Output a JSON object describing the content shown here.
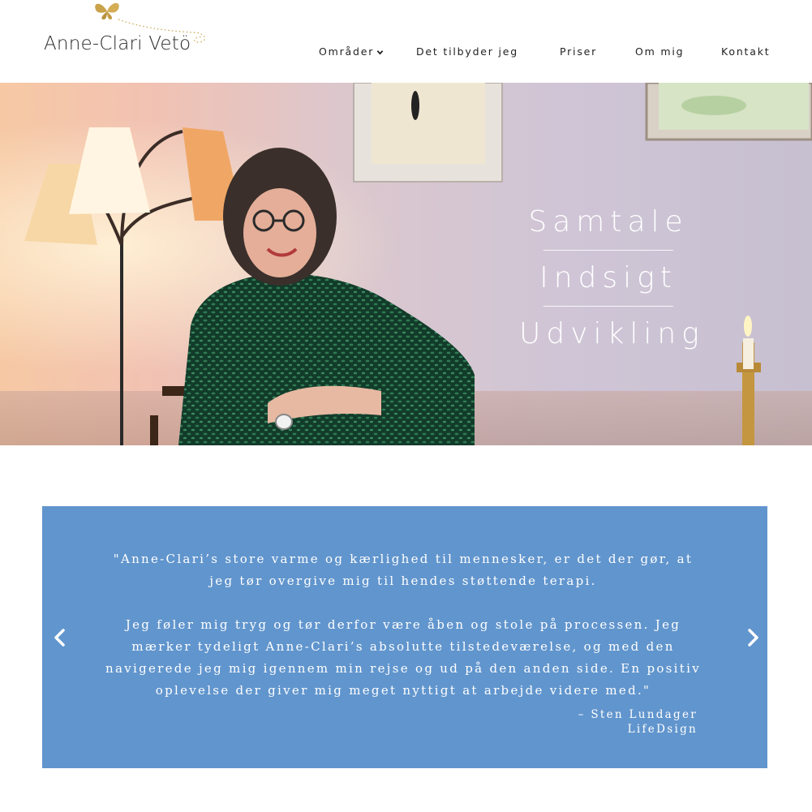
{
  "logo": {
    "name": "Anne-Clari Vetö"
  },
  "nav": {
    "items": [
      {
        "label": "Områder",
        "has_dropdown": true
      },
      {
        "label": "Det tilbyder jeg"
      },
      {
        "label": "Priser"
      },
      {
        "label": "Om mig"
      },
      {
        "label": "Kontakt"
      }
    ]
  },
  "hero": {
    "tagline": [
      "Samtale",
      "Indsigt",
      "Udvikling"
    ]
  },
  "testimonial": {
    "paragraphs": [
      "\"Anne-Clari’s store varme og kærlighed til mennesker, er det der gør, at jeg tør overgive mig til hendes støttende terapi.",
      "Jeg føler mig tryg og tør derfor være åben og stole på processen. Jeg mærker tydeligt Anne-Clari’s absolutte tilstedeværelse, og med den navigerede jeg mig igennem min rejse og ud på den anden side. En positiv oplevelse der giver mig meget nyttigt at arbejde videre med.\""
    ],
    "author": "– Sten Lundager",
    "company": "LifeDsign",
    "prev_icon": "chevron-left-icon",
    "next_icon": "chevron-right-icon"
  },
  "colors": {
    "accent_blue": "#6195cd",
    "logo_gold": "#c9a24a",
    "text_dark": "#222222"
  }
}
